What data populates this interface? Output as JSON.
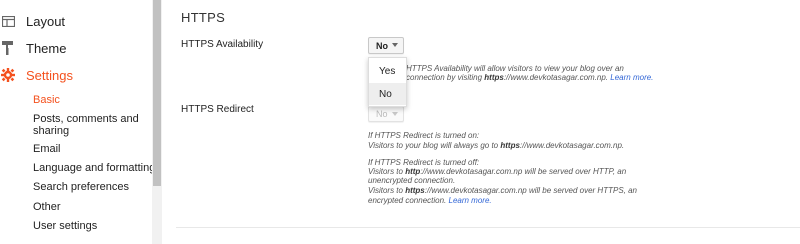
{
  "sidebar": {
    "layout_label": "Layout",
    "theme_label": "Theme",
    "settings_label": "Settings",
    "sub_items": [
      {
        "label": "Basic"
      },
      {
        "label": "Posts, comments and sharing"
      },
      {
        "label": "Email"
      },
      {
        "label": "Language and formatting"
      },
      {
        "label": "Search preferences"
      },
      {
        "label": "Other"
      },
      {
        "label": "User settings"
      }
    ]
  },
  "main": {
    "section_title": "HTTPS",
    "availability": {
      "label": "HTTPS Availability",
      "selected": "No",
      "help_pre": "HTTPS Availability will allow visitors to view your blog over an",
      "help_line2_a": "connection by visiting ",
      "help_line2_b": "https",
      "help_line2_c": "://www.devkotasagar.com.np.",
      "learn_more": "Learn more.",
      "options": [
        "Yes",
        "No"
      ]
    },
    "redirect": {
      "label": "HTTPS Redirect",
      "selected": "No",
      "on_title": "If HTTPS Redirect is turned on:",
      "on_text_a": "Visitors to your blog will always go to ",
      "on_text_b": "https",
      "on_text_c": "://www.devkotasagar.com.np.",
      "off_title": "If HTTPS Redirect is turned off:",
      "off_line1_a": "Visitors to ",
      "off_line1_b": "http",
      "off_line1_c": "://www.devkotasagar.com.np will be served over HTTP, an",
      "off_line2": "unencrypted connection.",
      "off_line3_a": "Visitors to ",
      "off_line3_b": "https",
      "off_line3_c": "://www.devkotasagar.com.np will be served over HTTPS, an",
      "off_line4_a": "encrypted connection. ",
      "learn_more": "Learn more."
    }
  },
  "colors": {
    "accent": "#f4511e",
    "link": "#3367d6"
  }
}
